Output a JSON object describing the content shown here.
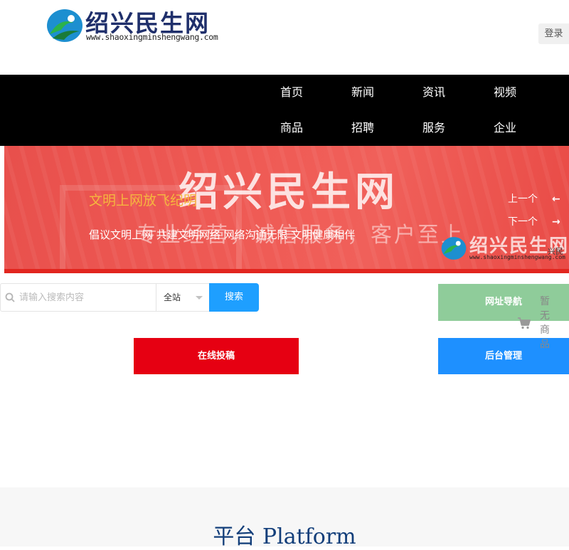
{
  "header": {
    "logo_title": "绍兴民生网",
    "logo_url": "www.shaoxingminshengwang.com",
    "login_label": "登录"
  },
  "nav": {
    "items": [
      "首页",
      "新闻",
      "资讯",
      "视频",
      "商品",
      "招聘",
      "服务",
      "企业"
    ]
  },
  "banner": {
    "bg_title": "绍兴民生网",
    "bg_slogan": "专业经营，诚信服务，客户至上",
    "bg_logo_title": "绍兴民生网",
    "bg_logo_url": "www.shaoxingminshengwang.com",
    "headline": "文明上网放飞纪明",
    "subtitle": "倡议文明上网 共建文明网络 网络沟通无限 文明健康相伴",
    "prev_label": "上一个",
    "next_label": "下一个",
    "peek_text": "兴民"
  },
  "search": {
    "placeholder": "请输入搜索内容",
    "value": "",
    "scope_selected": "全站",
    "button_label": "搜索"
  },
  "actions": {
    "nav_label": "网址导航",
    "submit_label": "在线投稿",
    "admin_label": "后台管理",
    "cart_empty": "暂无商品"
  },
  "platform": {
    "title": "平台  Platform"
  },
  "colors": {
    "nav_bg": "#000000",
    "search_button": "#1e9fff",
    "submit_button": "#e60012",
    "nav_button": "#8fcc9a",
    "admin_button": "#1e90ff",
    "platform_title": "#123e7a",
    "banner_headline": "#f5b63f"
  }
}
